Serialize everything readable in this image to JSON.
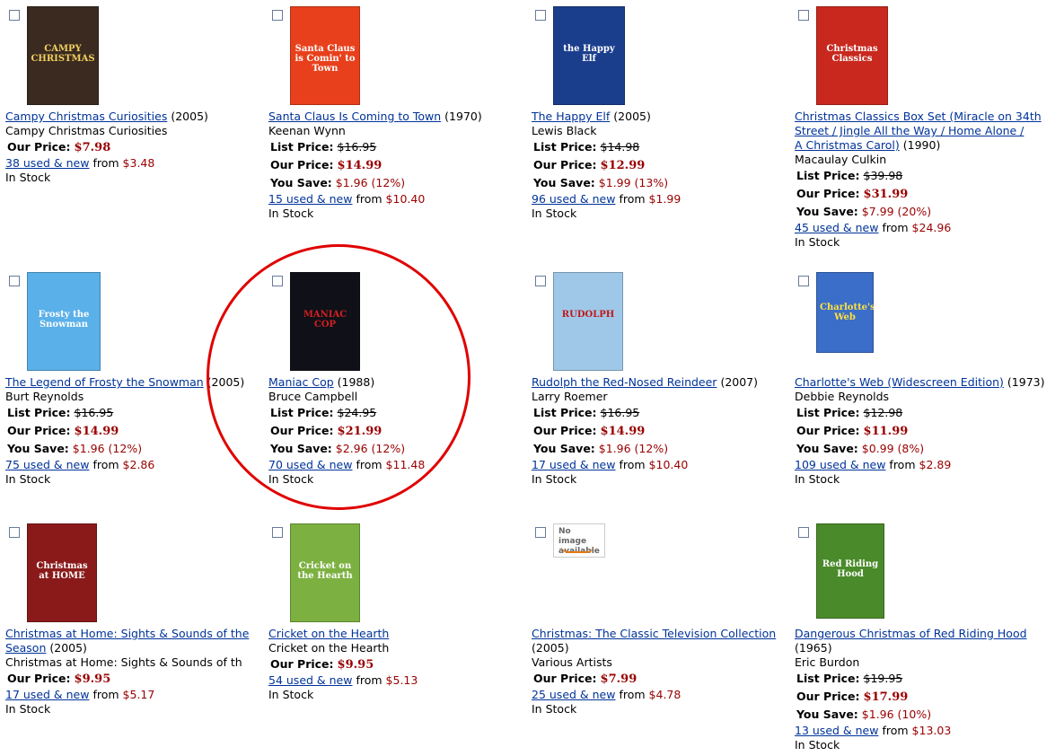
{
  "items": [
    {
      "title": "Campy Christmas Curiosities",
      "year": "(2005)",
      "person": "Campy Christmas Curiosities",
      "our_price": "$7.98",
      "used_link": "38 used & new",
      "from_label": "from",
      "from_price": "$3.48",
      "stock": "In Stock",
      "price_labels": {
        "our": "Our Price:"
      }
    },
    {
      "title": "Santa Claus Is Coming to Town",
      "year": "(1970)",
      "person": "Keenan Wynn",
      "list_price": "$16.95",
      "our_price": "$14.99",
      "you_save": "$1.96 (12%)",
      "used_link": "15 used & new",
      "from_label": "from",
      "from_price": "$10.40",
      "stock": "In Stock",
      "price_labels": {
        "list": "List Price:",
        "our": "Our Price:",
        "save": "You Save:"
      }
    },
    {
      "title": "The Happy Elf",
      "year": "(2005)",
      "person": "Lewis Black",
      "list_price": "$14.98",
      "our_price": "$12.99",
      "you_save": "$1.99 (13%)",
      "used_link": "96 used & new",
      "from_label": "from",
      "from_price": "$1.99",
      "stock": "In Stock",
      "price_labels": {
        "list": "List Price:",
        "our": "Our Price:",
        "save": "You Save:"
      }
    },
    {
      "title_lines": [
        "Christmas Classics Box Set (Miracle on 34th",
        "Street / Jingle All the Way / Home Alone /",
        "A Christmas Carol)"
      ],
      "year": "(1990)",
      "person": "Macaulay Culkin",
      "list_price": "$39.98",
      "our_price": "$31.99",
      "you_save": "$7.99 (20%)",
      "used_link": "45 used & new",
      "from_label": "from",
      "from_price": "$24.96",
      "stock": "In Stock",
      "price_labels": {
        "list": "List Price:",
        "our": "Our Price:",
        "save": "You Save:"
      }
    },
    {
      "title": "The Legend of Frosty the Snowman",
      "year": "(2005)",
      "person": "Burt Reynolds",
      "list_price": "$16.95",
      "our_price": "$14.99",
      "you_save": "$1.96 (12%)",
      "used_link": "75 used & new",
      "from_label": "from",
      "from_price": "$2.86",
      "stock": "In Stock",
      "price_labels": {
        "list": "List Price:",
        "our": "Our Price:",
        "save": "You Save:"
      }
    },
    {
      "title": "Maniac Cop",
      "year": "(1988)",
      "person": "Bruce Campbell",
      "list_price": "$24.95",
      "our_price": "$21.99",
      "you_save": "$2.96 (12%)",
      "used_link": "70 used & new",
      "from_label": "from",
      "from_price": "$11.48",
      "stock": "In Stock",
      "price_labels": {
        "list": "List Price:",
        "our": "Our Price:",
        "save": "You Save:"
      }
    },
    {
      "title": "Rudolph the Red-Nosed Reindeer",
      "year": "(2007)",
      "person": "Larry Roemer",
      "list_price": "$16.95",
      "our_price": "$14.99",
      "you_save": "$1.96 (12%)",
      "used_link": "17 used & new",
      "from_label": "from",
      "from_price": "$10.40",
      "stock": "In Stock",
      "price_labels": {
        "list": "List Price:",
        "our": "Our Price:",
        "save": "You Save:"
      }
    },
    {
      "title": "Charlotte's Web (Widescreen Edition)",
      "year": "(1973)",
      "person": "Debbie Reynolds",
      "list_price": "$12.98",
      "our_price": "$11.99",
      "you_save": "$0.99 (8%)",
      "used_link": "109 used & new",
      "from_label": "from",
      "from_price": "$2.89",
      "stock": "In Stock",
      "price_labels": {
        "list": "List Price:",
        "our": "Our Price:",
        "save": "You Save:"
      }
    },
    {
      "title_lines": [
        "Christmas at Home: Sights & Sounds of the",
        "Season"
      ],
      "year": "(2005)",
      "person": "Christmas at Home: Sights & Sounds of th",
      "our_price": "$9.95",
      "used_link": "17 used & new",
      "from_label": "from",
      "from_price": "$5.17",
      "stock": "In Stock",
      "price_labels": {
        "our": "Our Price:"
      }
    },
    {
      "title": "Cricket on the Hearth",
      "year": "",
      "person": "Cricket on the Hearth",
      "our_price": "$9.95",
      "used_link": "54 used & new",
      "from_label": "from",
      "from_price": "$5.13",
      "stock": "In Stock",
      "price_labels": {
        "our": "Our Price:"
      }
    },
    {
      "title": "Christmas: The Classic Television Collection",
      "year": "(2005)",
      "person": "Various Artists",
      "our_price": "$7.99",
      "used_link": "25 used & new",
      "from_label": "from",
      "from_price": "$4.78",
      "stock": "In Stock",
      "price_labels": {
        "our": "Our Price:"
      },
      "no_image": [
        "No image",
        "available"
      ]
    },
    {
      "title": "Dangerous Christmas of Red Riding Hood",
      "year": "(1965)",
      "person": "Eric Burdon",
      "list_price": "$19.95",
      "our_price": "$17.99",
      "you_save": "$1.96 (10%)",
      "used_link": "13 used & new",
      "from_label": "from",
      "from_price": "$13.03",
      "stock": "In Stock",
      "price_labels": {
        "list": "List Price:",
        "our": "Our Price:",
        "save": "You Save:"
      }
    }
  ],
  "covers": [
    {
      "text": "CAMPY CHRISTMAS",
      "bg": "#3a2a20",
      "fg": "#f0d060"
    },
    {
      "text": "Santa Claus is Comin' to Town",
      "bg": "#e8401c",
      "fg": "#ffffff"
    },
    {
      "text": "the Happy Elf",
      "bg": "#1b3e8c",
      "fg": "#ffffff"
    },
    {
      "text": "Christmas Classics",
      "bg": "#c8281e",
      "fg": "#ffffff"
    },
    {
      "text": "Frosty the Snowman",
      "bg": "#5ab0e8",
      "fg": "#ffffff"
    },
    {
      "text": "MANIAC COP",
      "bg": "#101018",
      "fg": "#d02020"
    },
    {
      "text": "RUDOLPH",
      "bg": "#9fc8e8",
      "fg": "#c01818"
    },
    {
      "text": "Charlotte's Web",
      "bg": "#3a6ec8",
      "fg": "#ffe040"
    },
    {
      "text": "Christmas at HOME",
      "bg": "#8a1a1a",
      "fg": "#ffffff"
    },
    {
      "text": "Cricket on the Hearth",
      "bg": "#7cb040",
      "fg": "#ffffff"
    },
    null,
    {
      "text": "Red Riding Hood",
      "bg": "#4a8a2a",
      "fg": "#ffffff"
    }
  ],
  "colors": {
    "link": "#003399",
    "price": "#990000",
    "highlight_circle": "#e00000"
  }
}
